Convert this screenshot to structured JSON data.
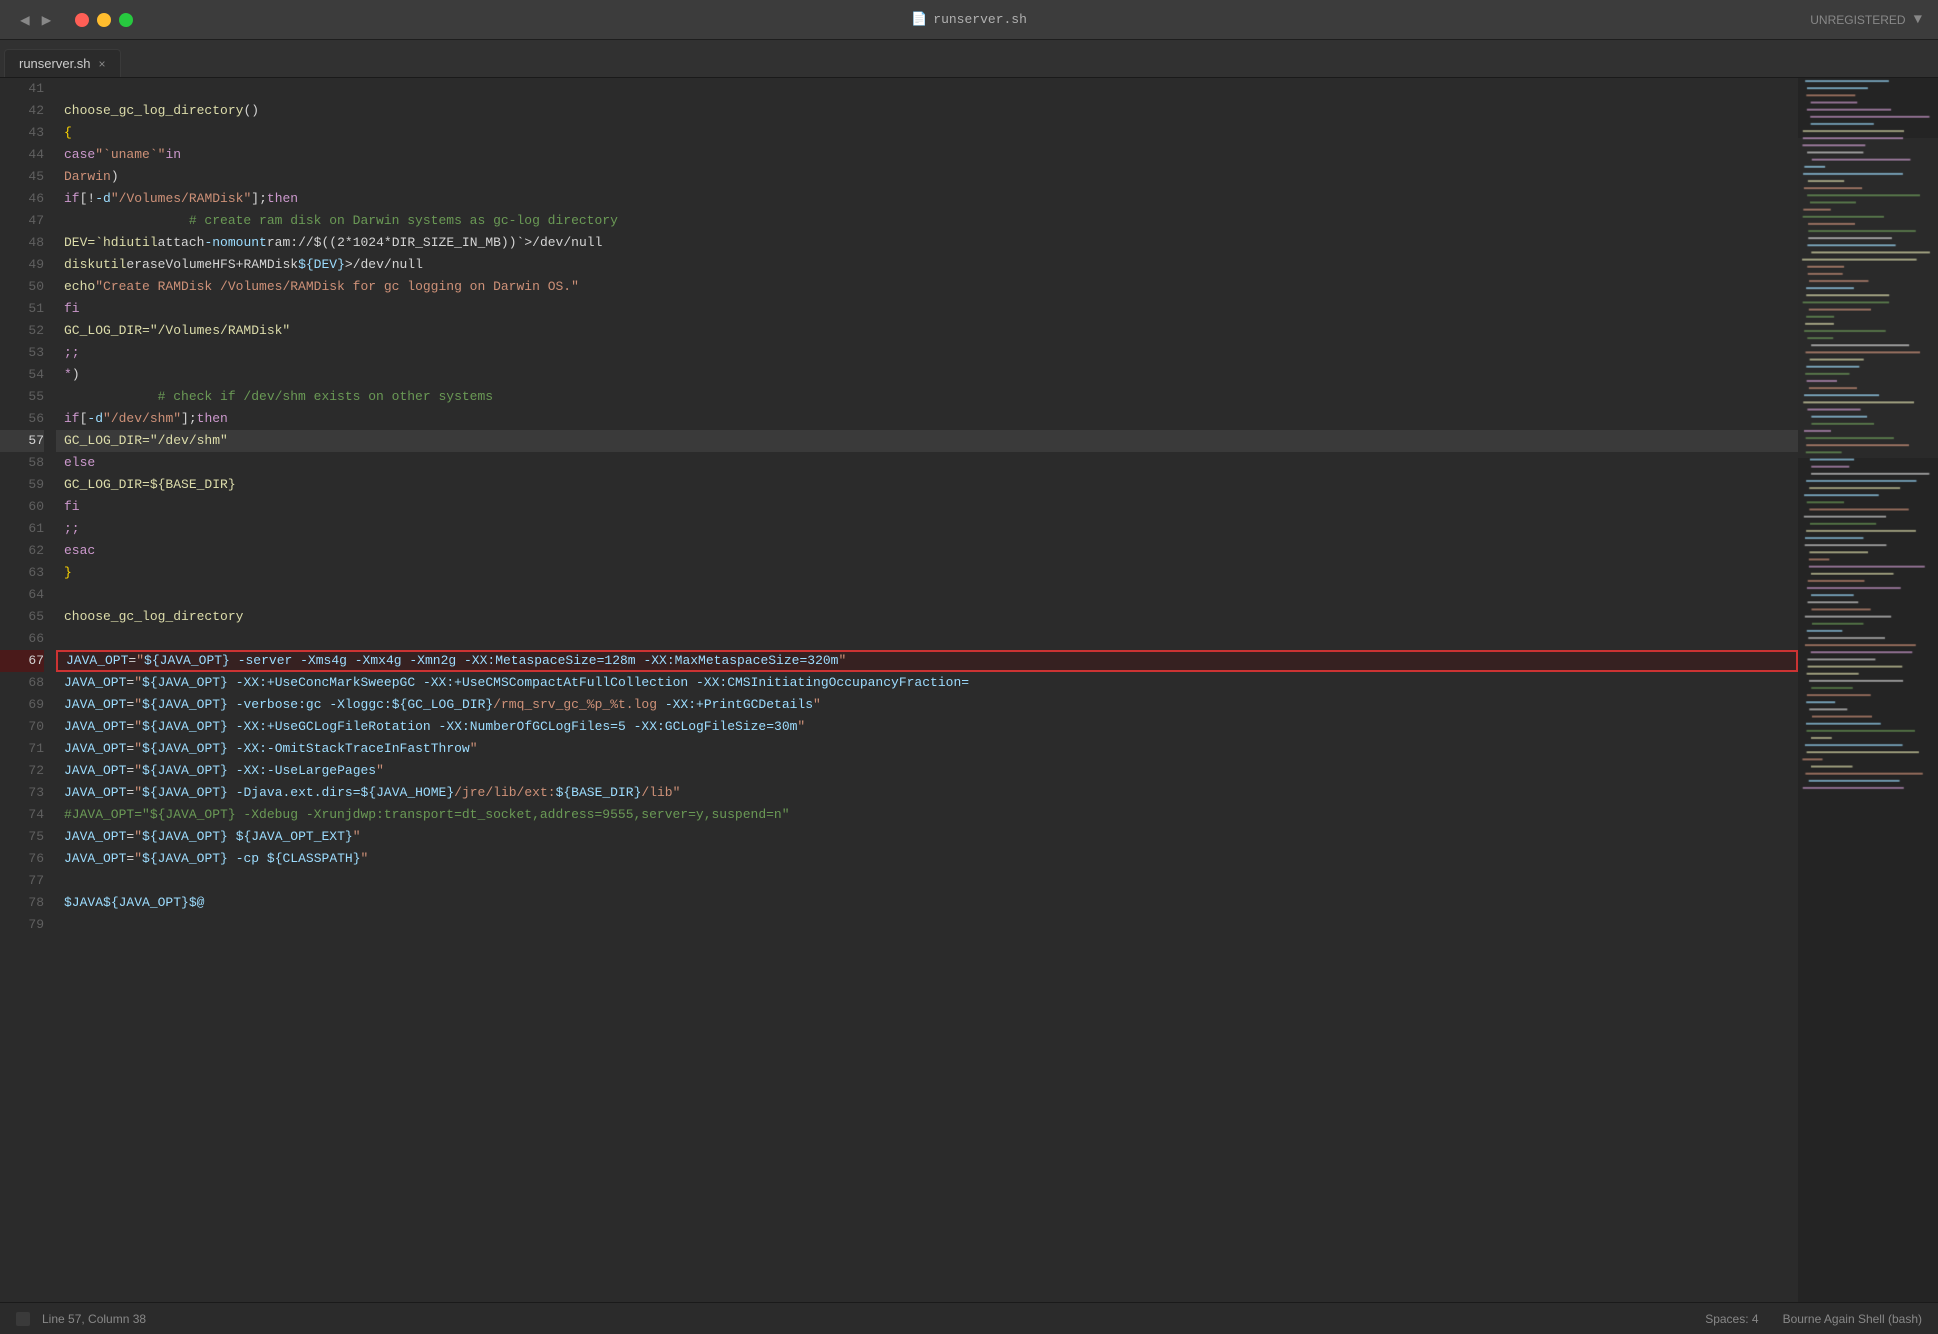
{
  "titleBar": {
    "title": "runserver.sh",
    "unregistered": "UNREGISTERED",
    "fileIcon": "📄"
  },
  "tab": {
    "label": "runserver.sh",
    "closeLabel": "×"
  },
  "statusBar": {
    "position": "Line 57, Column 38",
    "spaces": "Spaces: 4",
    "syntax": "Bourne Again Shell (bash)"
  },
  "lines": [
    {
      "num": 41,
      "content": ""
    },
    {
      "num": 42,
      "content": "choose_gc_log_directory()"
    },
    {
      "num": 43,
      "content": "{"
    },
    {
      "num": 44,
      "content": "    case \"`uname`\" in"
    },
    {
      "num": 45,
      "content": "        Darwin)"
    },
    {
      "num": 46,
      "content": "            if [ ! -d \"/Volumes/RAMDisk\" ]; then"
    },
    {
      "num": 47,
      "content": "                # create ram disk on Darwin systems as gc-log directory"
    },
    {
      "num": 48,
      "content": "                DEV=`hdiutil attach -nomount ram://$((2 * 1024 * DIR_SIZE_IN_MB))` > /dev/null"
    },
    {
      "num": 49,
      "content": "                diskutil eraseVolume HFS+ RAMDisk ${DEV} > /dev/null"
    },
    {
      "num": 50,
      "content": "                echo \"Create RAMDisk /Volumes/RAMDisk for gc logging on Darwin OS.\""
    },
    {
      "num": 51,
      "content": "            fi"
    },
    {
      "num": 52,
      "content": "            GC_LOG_DIR=\"/Volumes/RAMDisk\""
    },
    {
      "num": 53,
      "content": "        ;;"
    },
    {
      "num": 54,
      "content": "        *)"
    },
    {
      "num": 55,
      "content": "            # check if /dev/shm exists on other systems"
    },
    {
      "num": 56,
      "content": "            if [ -d \"/dev/shm\" ]; then"
    },
    {
      "num": 57,
      "content": "                GC_LOG_DIR=\"/dev/shm\"",
      "active": true
    },
    {
      "num": 58,
      "content": "            else"
    },
    {
      "num": 59,
      "content": "                GC_LOG_DIR=${BASE_DIR}"
    },
    {
      "num": 60,
      "content": "            fi"
    },
    {
      "num": 61,
      "content": "        ;;"
    },
    {
      "num": 62,
      "content": "        esac"
    },
    {
      "num": 63,
      "content": "}"
    },
    {
      "num": 64,
      "content": ""
    },
    {
      "num": 65,
      "content": "choose_gc_log_directory"
    },
    {
      "num": 66,
      "content": ""
    },
    {
      "num": 67,
      "content": "JAVA_OPT=\"${JAVA_OPT} -server -Xms4g -Xmx4g -Xmn2g -XX:MetaspaceSize=128m -XX:MaxMetaspaceSize=320m\"",
      "highlighted": true
    },
    {
      "num": 68,
      "content": "JAVA_OPT=\"${JAVA_OPT} -XX:+UseConcMarkSweepGC -XX:+UseCMSCompactAtFullCollection -XX:CMSInitiatingOccupancyFraction="
    },
    {
      "num": 69,
      "content": "JAVA_OPT=\"${JAVA_OPT} -verbose:gc -Xloggc:${GC_LOG_DIR}/rmq_srv_gc_%p_%t.log -XX:+PrintGCDetails\""
    },
    {
      "num": 70,
      "content": "JAVA_OPT=\"${JAVA_OPT} -XX:+UseGCLogFileRotation -XX:NumberOfGCLogFiles=5 -XX:GCLogFileSize=30m\""
    },
    {
      "num": 71,
      "content": "JAVA_OPT=\"${JAVA_OPT} -XX:-OmitStackTraceInFastThrow\""
    },
    {
      "num": 72,
      "content": "JAVA_OPT=\"${JAVA_OPT} -XX:-UseLargePages\""
    },
    {
      "num": 73,
      "content": "JAVA_OPT=\"${JAVA_OPT} -Djava.ext.dirs=${JAVA_HOME}/jre/lib/ext:${BASE_DIR}/lib\""
    },
    {
      "num": 74,
      "content": "#JAVA_OPT=\"${JAVA_OPT} -Xdebug -Xrunjdwp:transport=dt_socket,address=9555,server=y,suspend=n\""
    },
    {
      "num": 75,
      "content": "JAVA_OPT=\"${JAVA_OPT} ${JAVA_OPT_EXT}\""
    },
    {
      "num": 76,
      "content": "JAVA_OPT=\"${JAVA_OPT} -cp ${CLASSPATH}\""
    },
    {
      "num": 77,
      "content": ""
    },
    {
      "num": 78,
      "content": "$JAVA ${JAVA_OPT} $@"
    },
    {
      "num": 79,
      "content": ""
    }
  ]
}
